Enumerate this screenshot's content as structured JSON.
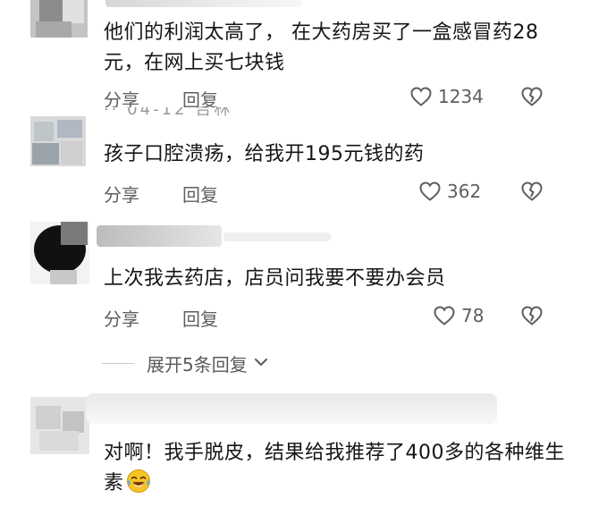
{
  "comments": [
    {
      "text": "他们的利润太高了， 在大药房买了一盒感冒药28元，在网上买七块钱",
      "share_label": "分享",
      "reply_label": "回复",
      "likes": "1234"
    },
    {
      "meta": "·· 04-12 吉林",
      "text": "孩子口腔溃疡，给我开195元钱的药",
      "share_label": "分享",
      "reply_label": "回复",
      "likes": "362"
    },
    {
      "text": "上次我去药店，店员问我要不要办会员",
      "share_label": "分享",
      "reply_label": "回复",
      "likes": "78",
      "expand_label": "展开5条回复"
    },
    {
      "text": "对啊！我手脱皮，结果给我推荐了400多的各种维生素",
      "emoji": "laughing-crying-emoji"
    }
  ],
  "icons": {
    "like": "heart-outline-icon",
    "dislike": "broken-heart-icon",
    "expand": "chevron-down-icon"
  },
  "colors": {
    "text": "#151515",
    "secondary": "#5e5e5e",
    "emoji": "#f7c325"
  }
}
